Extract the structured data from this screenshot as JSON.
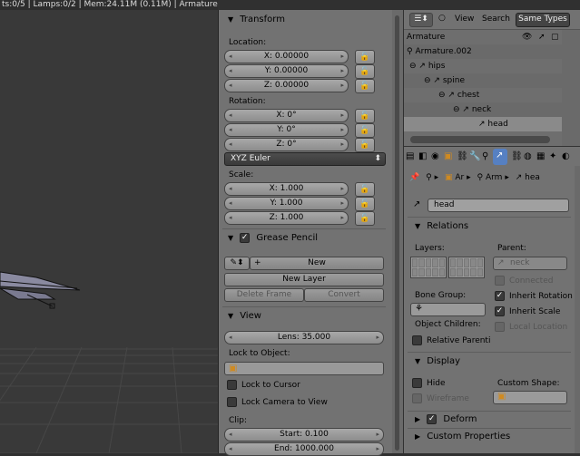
{
  "infobar": {
    "text": "ts:0/5 | Lamps:0/2 | Mem:24.11M (0.11M) | Armature"
  },
  "transform": {
    "title": "Transform",
    "location_label": "Location:",
    "location": [
      "X: 0.00000",
      "Y: 0.00000",
      "Z: 0.00000"
    ],
    "rotation_label": "Rotation:",
    "rotation": [
      "X: 0°",
      "Y: 0°",
      "Z: 0°"
    ],
    "rotation_mode": "XYZ Euler",
    "scale_label": "Scale:",
    "scale": [
      "X: 1.000",
      "Y: 1.000",
      "Z: 1.000"
    ]
  },
  "grease_pencil": {
    "title": "Grease Pencil",
    "new_label": "New",
    "new_layer_label": "New Layer",
    "delete_frame_label": "Delete Frame",
    "convert_label": "Convert"
  },
  "view": {
    "title": "View",
    "lens": "Lens: 35.000",
    "lock_to_object_label": "Lock to Object:",
    "lock_to_cursor": "Lock to Cursor",
    "lock_camera_to_view": "Lock Camera to View",
    "clip_label": "Clip:",
    "clip_start": "Start: 0.100",
    "clip_end": "End: 1000.000"
  },
  "outliner_header": {
    "view": "View",
    "search": "Search",
    "filter": "Same Types"
  },
  "outliner": {
    "rows": [
      {
        "label": "Armature",
        "depth": 0
      },
      {
        "label": "Armature.002",
        "depth": 0
      },
      {
        "label": "hips",
        "depth": 1
      },
      {
        "label": "spine",
        "depth": 2
      },
      {
        "label": "chest",
        "depth": 3
      },
      {
        "label": "neck",
        "depth": 4
      },
      {
        "label": "head",
        "depth": 5
      }
    ]
  },
  "breadcrumb": {
    "a": "Ar",
    "b": "Arm",
    "c": "hea"
  },
  "bone": {
    "name": "head"
  },
  "relations": {
    "title": "Relations",
    "layers_label": "Layers:",
    "parent_label": "Parent:",
    "parent_value": "neck",
    "connected": "Connected",
    "bone_group_label": "Bone Group:",
    "inherit_rotation": "Inherit Rotation",
    "inherit_scale": "Inherit Scale",
    "object_children_label": "Object Children:",
    "local_location": "Local Location",
    "relative_parenting": "Relative Parenti"
  },
  "display": {
    "title": "Display",
    "hide": "Hide",
    "custom_shape_label": "Custom Shape:",
    "wireframe": "Wireframe"
  },
  "deform": {
    "title": "Deform"
  },
  "custom_properties": {
    "title": "Custom Properties"
  }
}
